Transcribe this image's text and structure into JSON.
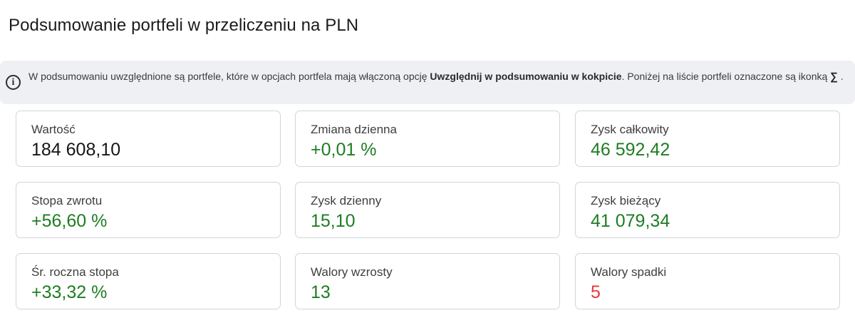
{
  "header": {
    "title": "Podsumowanie portfeli w przeliczeniu na PLN"
  },
  "info": {
    "text_before": "W podsumowaniu uwzględnione są portfele, które w opcjach portfela mają włączoną opcję ",
    "bold_option": "Uwzględnij w podsumowaniu w kokpicie",
    "text_after": ". Poniżej na liście portfeli oznaczone są ikonką ",
    "sigma_symbol": "∑",
    "text_end": " .",
    "icon": "info-circle-icon"
  },
  "cards": [
    {
      "label": "Wartość",
      "value": "184 608,10",
      "color": "#151515"
    },
    {
      "label": "Zmiana dzienna",
      "value": "+0,01 %",
      "color": "#1e7d22"
    },
    {
      "label": "Zysk całkowity",
      "value": "46 592,42",
      "color": "#1e7d22"
    },
    {
      "label": "Stopa zwrotu",
      "value": "+56,60 %",
      "color": "#1e7d22"
    },
    {
      "label": "Zysk dzienny",
      "value": "15,10",
      "color": "#1e7d22"
    },
    {
      "label": "Zysk bieżący",
      "value": "41 079,34",
      "color": "#1e7d22"
    },
    {
      "label": "Śr. roczna stopa",
      "value": "+33,32 %",
      "color": "#1e7d22"
    },
    {
      "label": "Walory wzrosty",
      "value": "13",
      "color": "#1e7d22"
    },
    {
      "label": "Walory spadki",
      "value": "5",
      "color": "#e53935"
    }
  ]
}
